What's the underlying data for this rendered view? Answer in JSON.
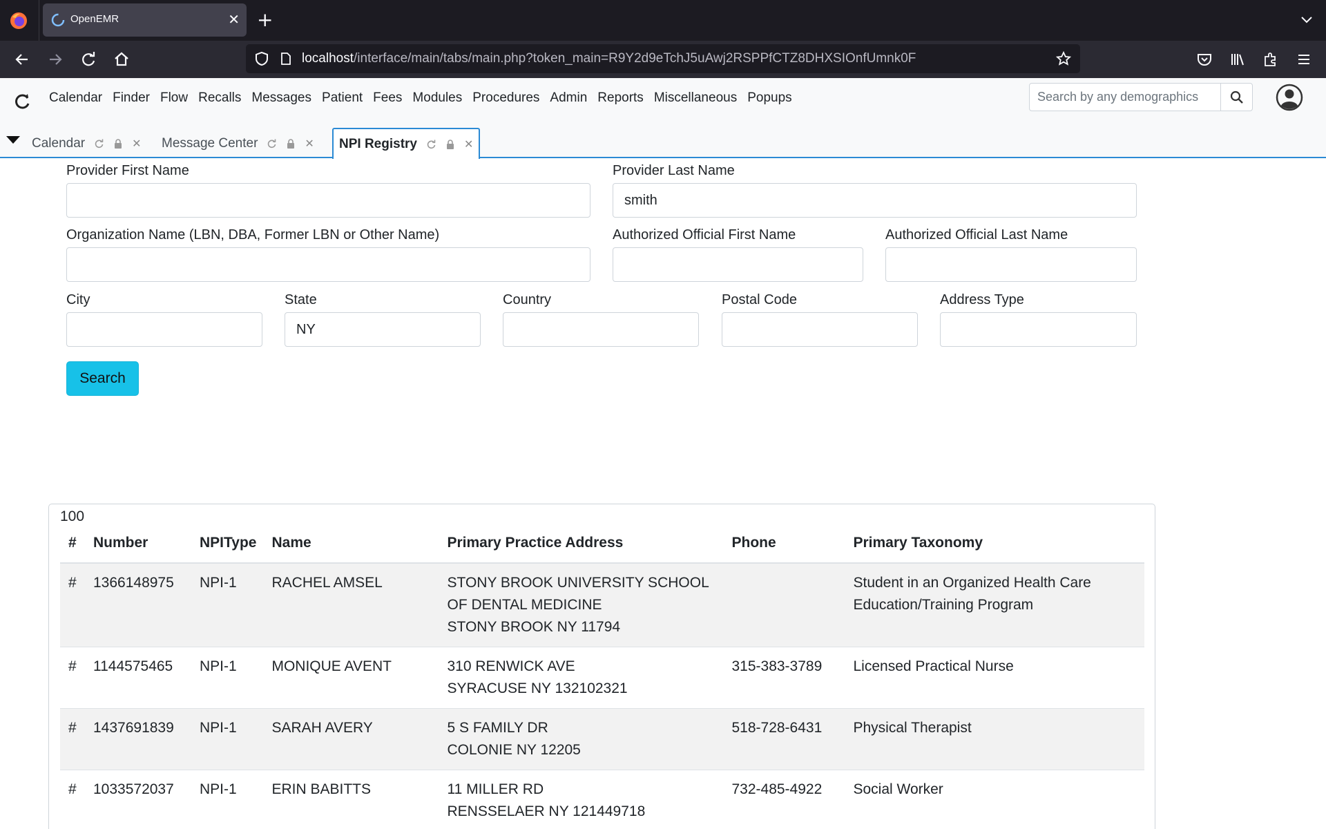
{
  "browser": {
    "tab_title": "OpenEMR",
    "url_host": "localhost",
    "url_path": "/interface/main/tabs/main.php?token_main=R9Y2d9eTchJ5uAwj2RSPPfCTZ8DHXSIOnfUmnk0F"
  },
  "header": {
    "menu": [
      "Calendar",
      "Finder",
      "Flow",
      "Recalls",
      "Messages",
      "Patient",
      "Fees",
      "Modules",
      "Procedures",
      "Admin",
      "Reports",
      "Miscellaneous",
      "Popups"
    ],
    "search_placeholder": "Search by any demographics"
  },
  "tabs": [
    {
      "label": "Calendar",
      "active": false
    },
    {
      "label": "Message Center",
      "active": false
    },
    {
      "label": "NPI Registry",
      "active": true
    }
  ],
  "form": {
    "provider_first_name": {
      "label": "Provider First Name",
      "value": ""
    },
    "provider_last_name": {
      "label": "Provider Last Name",
      "value": "smith"
    },
    "organization_name": {
      "label": "Organization Name (LBN, DBA, Former LBN or Other Name)",
      "value": ""
    },
    "auth_first_name": {
      "label": "Authorized Official First Name",
      "value": ""
    },
    "auth_last_name": {
      "label": "Authorized Official Last Name",
      "value": ""
    },
    "city": {
      "label": "City",
      "value": ""
    },
    "state": {
      "label": "State",
      "value": "NY"
    },
    "country": {
      "label": "Country",
      "value": ""
    },
    "postal_code": {
      "label": "Postal Code",
      "value": ""
    },
    "address_type": {
      "label": "Address Type",
      "value": ""
    },
    "search_button": "Search"
  },
  "results": {
    "count": "100",
    "headers": {
      "hash": "#",
      "number": "Number",
      "npi_type_line1": "NPI",
      "npi_type_line2": "Type",
      "name": "Name",
      "address": "Primary Practice Address",
      "phone": "Phone",
      "taxonomy": "Primary Taxonomy"
    },
    "rows": [
      {
        "hash": "#",
        "number": "1366148975",
        "type": "NPI-1",
        "name": "RACHEL AMSEL",
        "addr1": "STONY BROOK UNIVERSITY SCHOOL",
        "addr2": "OF DENTAL MEDICINE",
        "addr3": "STONY BROOK NY 11794",
        "phone": "",
        "tax1": "Student in an Organized Health Care",
        "tax2": "Education/Training Program"
      },
      {
        "hash": "#",
        "number": "1144575465",
        "type": "NPI-1",
        "name": "MONIQUE AVENT",
        "addr1": "310 RENWICK AVE",
        "addr2": "SYRACUSE NY 132102321",
        "addr3": "",
        "phone": "315-383-3789",
        "tax1": "Licensed Practical Nurse",
        "tax2": ""
      },
      {
        "hash": "#",
        "number": "1437691839",
        "type": "NPI-1",
        "name": "SARAH AVERY",
        "addr1": "5 S FAMILY DR",
        "addr2": "COLONIE NY 12205",
        "addr3": "",
        "phone": "518-728-6431",
        "tax1": "Physical Therapist",
        "tax2": ""
      },
      {
        "hash": "#",
        "number": "1033572037",
        "type": "NPI-1",
        "name": "ERIN BABITTS",
        "addr1": "11 MILLER RD",
        "addr2": "RENSSELAER NY 121449718",
        "addr3": "",
        "phone": "732-485-4922",
        "tax1": "Social Worker",
        "tax2": ""
      }
    ]
  }
}
